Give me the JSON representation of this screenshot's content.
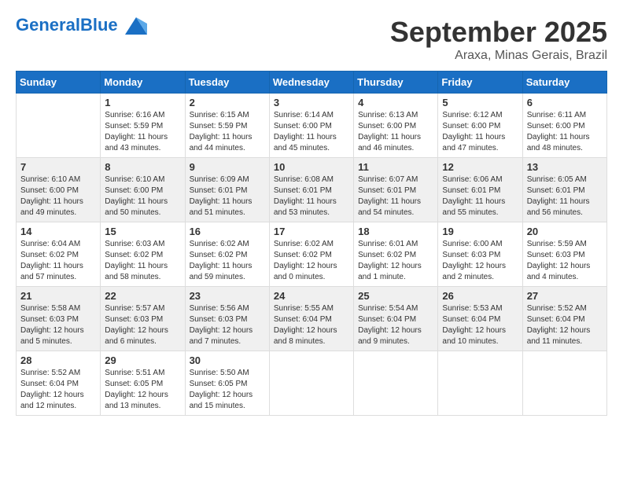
{
  "header": {
    "logo_text_general": "General",
    "logo_text_blue": "Blue",
    "month_title": "September 2025",
    "location": "Araxa, Minas Gerais, Brazil"
  },
  "weekdays": [
    "Sunday",
    "Monday",
    "Tuesday",
    "Wednesday",
    "Thursday",
    "Friday",
    "Saturday"
  ],
  "weeks": [
    [
      {
        "day": "",
        "info": ""
      },
      {
        "day": "1",
        "info": "Sunrise: 6:16 AM\nSunset: 5:59 PM\nDaylight: 11 hours\nand 43 minutes."
      },
      {
        "day": "2",
        "info": "Sunrise: 6:15 AM\nSunset: 5:59 PM\nDaylight: 11 hours\nand 44 minutes."
      },
      {
        "day": "3",
        "info": "Sunrise: 6:14 AM\nSunset: 6:00 PM\nDaylight: 11 hours\nand 45 minutes."
      },
      {
        "day": "4",
        "info": "Sunrise: 6:13 AM\nSunset: 6:00 PM\nDaylight: 11 hours\nand 46 minutes."
      },
      {
        "day": "5",
        "info": "Sunrise: 6:12 AM\nSunset: 6:00 PM\nDaylight: 11 hours\nand 47 minutes."
      },
      {
        "day": "6",
        "info": "Sunrise: 6:11 AM\nSunset: 6:00 PM\nDaylight: 11 hours\nand 48 minutes."
      }
    ],
    [
      {
        "day": "7",
        "info": "Sunrise: 6:10 AM\nSunset: 6:00 PM\nDaylight: 11 hours\nand 49 minutes."
      },
      {
        "day": "8",
        "info": "Sunrise: 6:10 AM\nSunset: 6:00 PM\nDaylight: 11 hours\nand 50 minutes."
      },
      {
        "day": "9",
        "info": "Sunrise: 6:09 AM\nSunset: 6:01 PM\nDaylight: 11 hours\nand 51 minutes."
      },
      {
        "day": "10",
        "info": "Sunrise: 6:08 AM\nSunset: 6:01 PM\nDaylight: 11 hours\nand 53 minutes."
      },
      {
        "day": "11",
        "info": "Sunrise: 6:07 AM\nSunset: 6:01 PM\nDaylight: 11 hours\nand 54 minutes."
      },
      {
        "day": "12",
        "info": "Sunrise: 6:06 AM\nSunset: 6:01 PM\nDaylight: 11 hours\nand 55 minutes."
      },
      {
        "day": "13",
        "info": "Sunrise: 6:05 AM\nSunset: 6:01 PM\nDaylight: 11 hours\nand 56 minutes."
      }
    ],
    [
      {
        "day": "14",
        "info": "Sunrise: 6:04 AM\nSunset: 6:02 PM\nDaylight: 11 hours\nand 57 minutes."
      },
      {
        "day": "15",
        "info": "Sunrise: 6:03 AM\nSunset: 6:02 PM\nDaylight: 11 hours\nand 58 minutes."
      },
      {
        "day": "16",
        "info": "Sunrise: 6:02 AM\nSunset: 6:02 PM\nDaylight: 11 hours\nand 59 minutes."
      },
      {
        "day": "17",
        "info": "Sunrise: 6:02 AM\nSunset: 6:02 PM\nDaylight: 12 hours\nand 0 minutes."
      },
      {
        "day": "18",
        "info": "Sunrise: 6:01 AM\nSunset: 6:02 PM\nDaylight: 12 hours\nand 1 minute."
      },
      {
        "day": "19",
        "info": "Sunrise: 6:00 AM\nSunset: 6:03 PM\nDaylight: 12 hours\nand 2 minutes."
      },
      {
        "day": "20",
        "info": "Sunrise: 5:59 AM\nSunset: 6:03 PM\nDaylight: 12 hours\nand 4 minutes."
      }
    ],
    [
      {
        "day": "21",
        "info": "Sunrise: 5:58 AM\nSunset: 6:03 PM\nDaylight: 12 hours\nand 5 minutes."
      },
      {
        "day": "22",
        "info": "Sunrise: 5:57 AM\nSunset: 6:03 PM\nDaylight: 12 hours\nand 6 minutes."
      },
      {
        "day": "23",
        "info": "Sunrise: 5:56 AM\nSunset: 6:03 PM\nDaylight: 12 hours\nand 7 minutes."
      },
      {
        "day": "24",
        "info": "Sunrise: 5:55 AM\nSunset: 6:04 PM\nDaylight: 12 hours\nand 8 minutes."
      },
      {
        "day": "25",
        "info": "Sunrise: 5:54 AM\nSunset: 6:04 PM\nDaylight: 12 hours\nand 9 minutes."
      },
      {
        "day": "26",
        "info": "Sunrise: 5:53 AM\nSunset: 6:04 PM\nDaylight: 12 hours\nand 10 minutes."
      },
      {
        "day": "27",
        "info": "Sunrise: 5:52 AM\nSunset: 6:04 PM\nDaylight: 12 hours\nand 11 minutes."
      }
    ],
    [
      {
        "day": "28",
        "info": "Sunrise: 5:52 AM\nSunset: 6:04 PM\nDaylight: 12 hours\nand 12 minutes."
      },
      {
        "day": "29",
        "info": "Sunrise: 5:51 AM\nSunset: 6:05 PM\nDaylight: 12 hours\nand 13 minutes."
      },
      {
        "day": "30",
        "info": "Sunrise: 5:50 AM\nSunset: 6:05 PM\nDaylight: 12 hours\nand 15 minutes."
      },
      {
        "day": "",
        "info": ""
      },
      {
        "day": "",
        "info": ""
      },
      {
        "day": "",
        "info": ""
      },
      {
        "day": "",
        "info": ""
      }
    ]
  ]
}
